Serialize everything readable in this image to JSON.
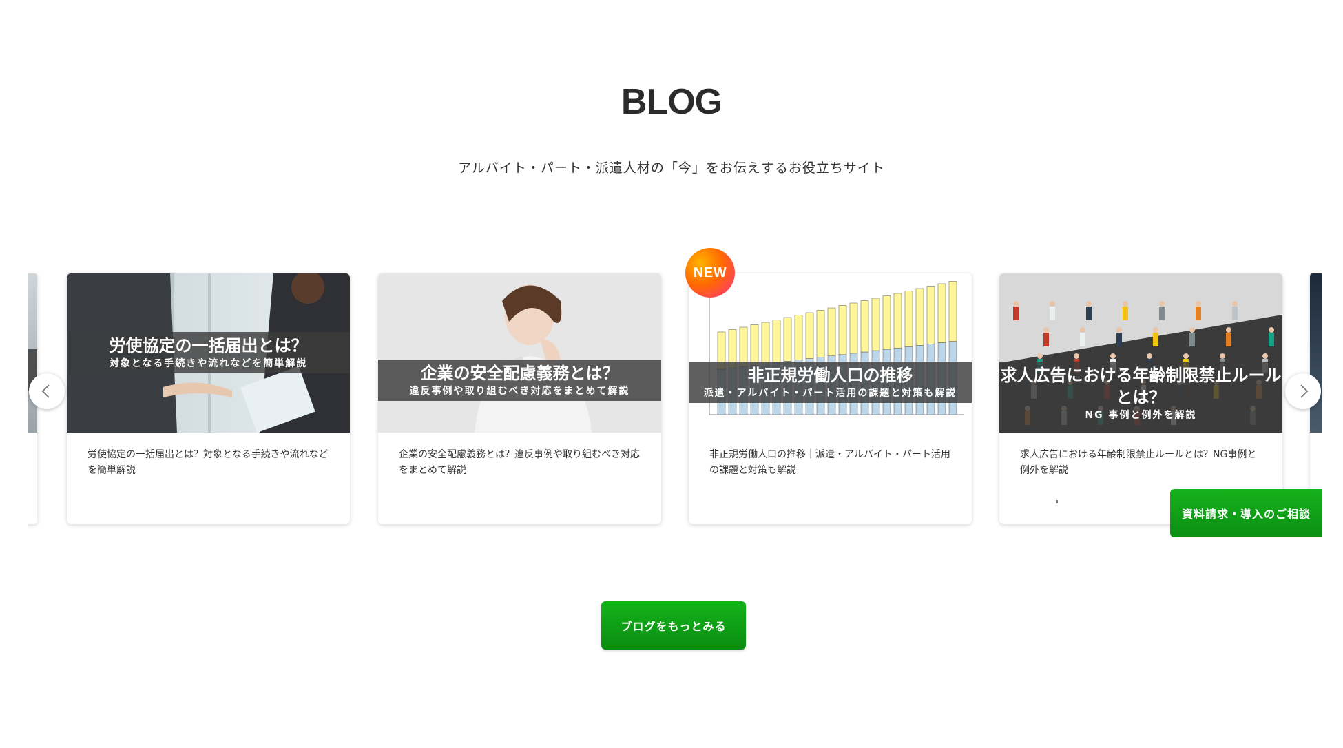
{
  "section": {
    "title": "BLOG",
    "subtitle": "アルバイト・パート・派遣人材の「今」をお伝えするお役立ちサイト"
  },
  "cards": [
    {
      "overlay_title": "労使協定の一括届出とは？",
      "overlay_sub": "対象となる手続きや流れなどを簡単解説",
      "caption": "労使協定の一括届出とは？対象となる手続きや流れなどを簡単解説"
    },
    {
      "overlay_title": "企業の安全配慮義務とは？",
      "overlay_sub": "違反事例や取り組むべき対応をまとめて解説",
      "caption": "企業の安全配慮義務とは？違反事例や取り組むべき対応をまとめて解説"
    },
    {
      "badge": "NEW",
      "overlay_title": "非正規労働人口の推移",
      "overlay_sub": "派遣・アルバイト・パート活用の課題と対策も解説",
      "caption": "非正規労働人口の推移｜派遣・アルバイト・パート活用の課題と対策も解説"
    },
    {
      "overlay_title": "求人広告における年齢制限禁止ルールとは？",
      "overlay_sub": "NG 事例と例外を解説",
      "caption": "求人広告における年齢制限禁止ルールとは？NG事例と例外を解説"
    }
  ],
  "cta": {
    "label": "資料請求・導入のご相談"
  },
  "more_button": {
    "label": "ブログをもっとみる"
  },
  "colors": {
    "accent_green": "#0f9f17",
    "overlay": "#3c3c3c"
  }
}
